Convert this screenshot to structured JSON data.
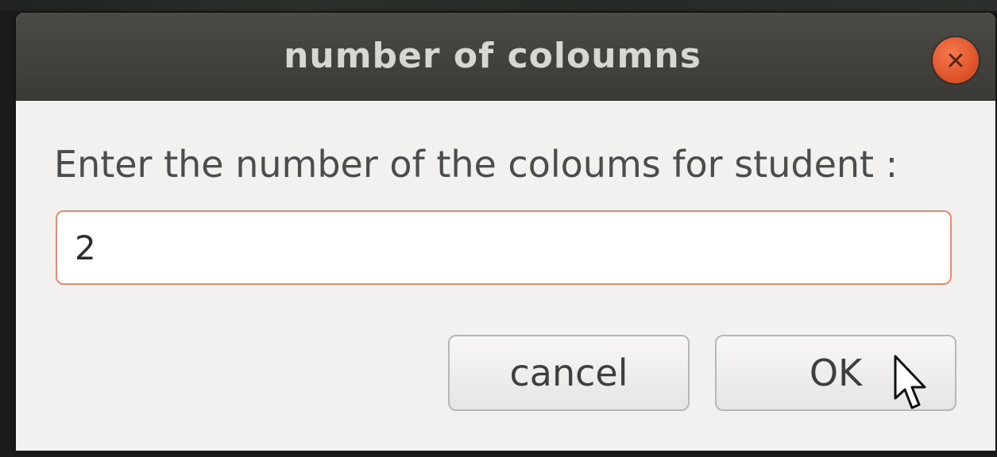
{
  "dialog": {
    "title": "number of coloumns",
    "prompt": "Enter the number of the coloums for student :",
    "input_value": "2",
    "cancel_label": "cancel",
    "ok_label": "OK"
  },
  "colors": {
    "titlebar": "#3f3e3a",
    "close_button": "#e0552a",
    "field_border": "#e98a6a",
    "body": "#f2f1f0"
  },
  "icons": {
    "close": "close-icon",
    "cursor": "mouse-pointer-icon"
  }
}
